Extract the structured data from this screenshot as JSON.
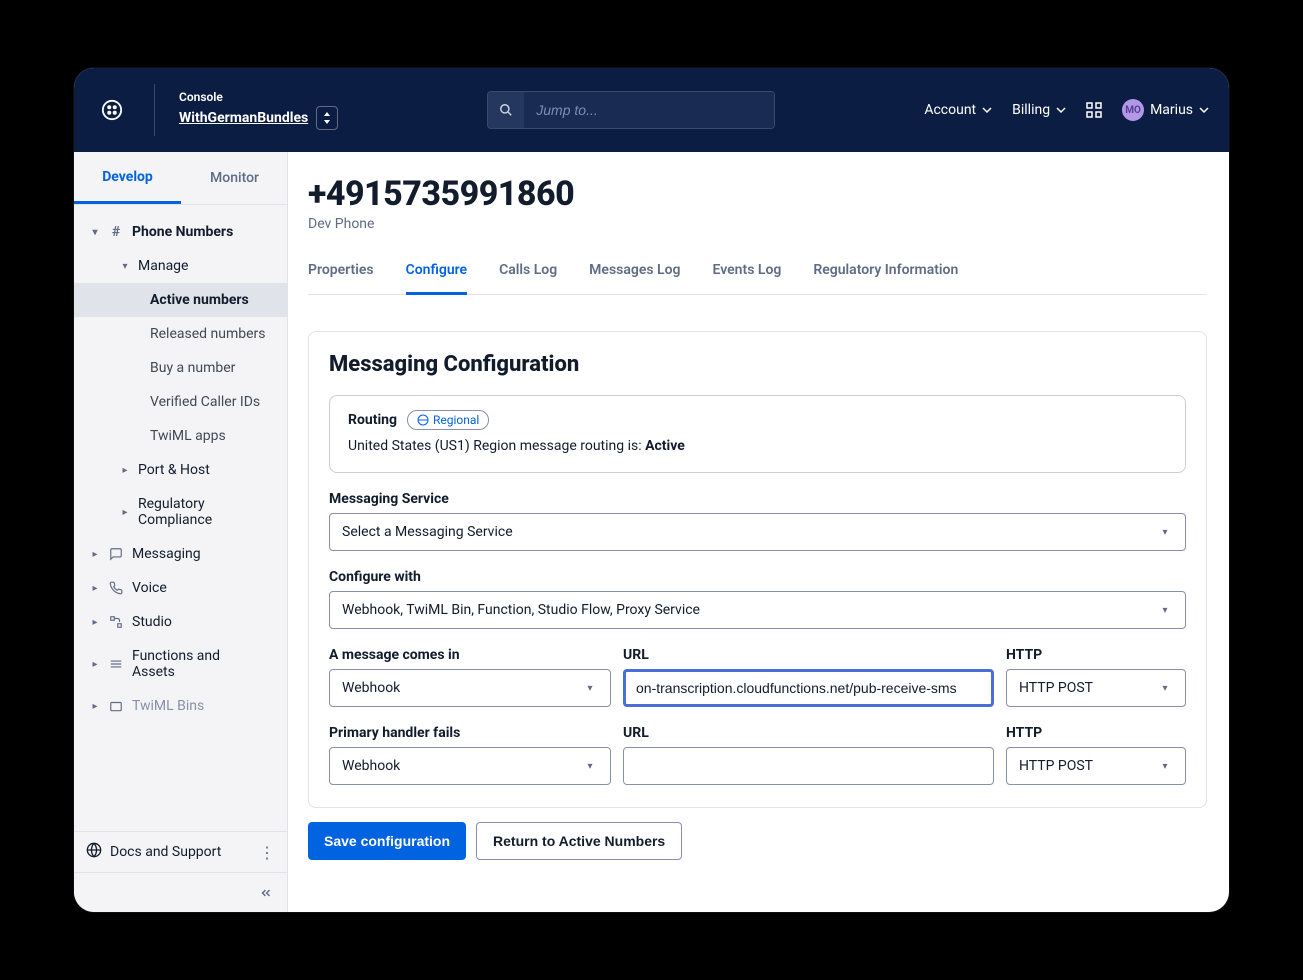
{
  "header": {
    "console_label": "Console",
    "project_name": "WithGermanBundles",
    "search_placeholder": "Jump to...",
    "account_label": "Account",
    "billing_label": "Billing",
    "user_name": "Marius",
    "user_initials": "MO"
  },
  "sidebar": {
    "tabs": {
      "develop": "Develop",
      "monitor": "Monitor"
    },
    "phone_numbers": "Phone Numbers",
    "manage": "Manage",
    "manage_items": {
      "active": "Active numbers",
      "released": "Released numbers",
      "buy": "Buy a number",
      "verified": "Verified Caller IDs",
      "twiml": "TwiML apps"
    },
    "port_host": "Port & Host",
    "reg_compliance": "Regulatory Compliance",
    "messaging": "Messaging",
    "voice": "Voice",
    "studio": "Studio",
    "functions": "Functions and Assets",
    "twiml_bins": "TwiML Bins",
    "docs_support": "Docs and Support"
  },
  "page": {
    "title": "+4915735991860",
    "subtitle": "Dev Phone",
    "tabs": {
      "properties": "Properties",
      "configure": "Configure",
      "calls_log": "Calls Log",
      "messages_log": "Messages Log",
      "events_log": "Events Log",
      "regulatory": "Regulatory Information"
    }
  },
  "config": {
    "heading": "Messaging Configuration",
    "routing": {
      "label": "Routing",
      "badge": "Regional",
      "text_prefix": "United States (US1) Region message routing is: ",
      "text_status": "Active"
    },
    "messaging_service": {
      "label": "Messaging Service",
      "value": "Select a Messaging Service"
    },
    "configure_with": {
      "label": "Configure with",
      "value": "Webhook, TwiML Bin, Function, Studio Flow, Proxy Service"
    },
    "comes_in": {
      "label": "A message comes in",
      "handler_value": "Webhook",
      "url_label": "URL",
      "url_value": "on-transcription.cloudfunctions.net/pub-receive-sms",
      "http_label": "HTTP",
      "http_value": "HTTP POST"
    },
    "fails": {
      "label": "Primary handler fails",
      "handler_value": "Webhook",
      "url_label": "URL",
      "url_value": "",
      "http_label": "HTTP",
      "http_value": "HTTP POST"
    }
  },
  "buttons": {
    "save": "Save configuration",
    "return": "Return to Active Numbers"
  }
}
